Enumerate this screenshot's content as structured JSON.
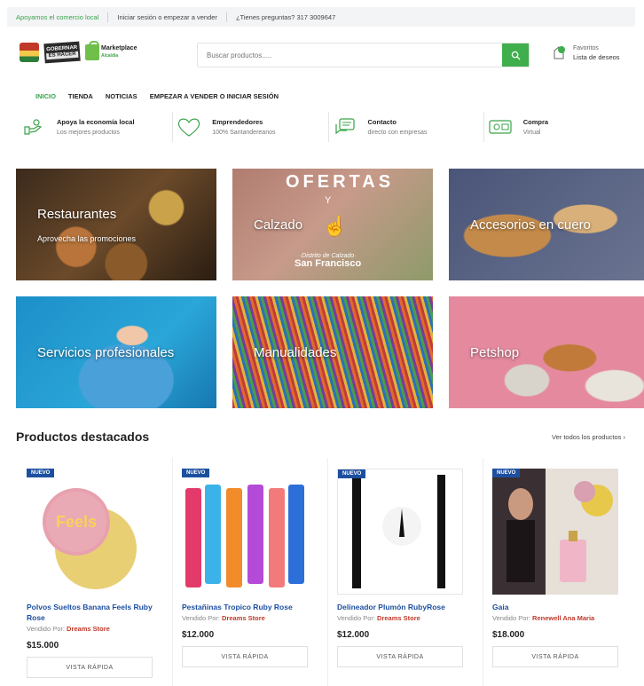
{
  "topbar": {
    "support_link": "Apoyamos el comercio local",
    "login_link": "Iniciar sesión o empezar a vender",
    "phone": "¿Tienes preguntas? 317 3009647"
  },
  "header": {
    "logo_gob_line1": "GOBERNAR",
    "logo_gob_line2": "ES HACER",
    "logo_mkt_name": "Marketplace",
    "logo_mkt_sub": "Alcaldía",
    "search_placeholder": "Buscar productos.....",
    "favorites_label": "Favoritos",
    "wishlist_label": "Lista de deseos"
  },
  "nav": {
    "items": [
      {
        "label": "INICIO",
        "active": true
      },
      {
        "label": "TIENDA"
      },
      {
        "label": "NOTICIAS"
      },
      {
        "label": "EMPEZAR A VENDER O INICIAR SESIÓN"
      }
    ]
  },
  "features": [
    {
      "icon": "handshake-icon",
      "title": "Apoya la economía local",
      "subtitle": "Los mejores productos"
    },
    {
      "icon": "heart-icon",
      "title": "Emprendedores",
      "subtitle": "100% Santandereanos"
    },
    {
      "icon": "chat-icon",
      "title": "Contacto",
      "subtitle": "directo con empresas"
    },
    {
      "icon": "card-icon",
      "title": "Compra",
      "subtitle": "Virtual"
    }
  ],
  "categories": [
    {
      "title": "Restaurantes",
      "subtitle": "Aprovecha las promociones"
    },
    {
      "title": "Calzado",
      "banner_top": "OFERTAS",
      "banner_mid": "Y",
      "banner_line1": "·Distrito de Calzado·",
      "banner_line2": "San Francisco"
    },
    {
      "title": "Accesorios en cuero"
    },
    {
      "title": "Servicios profesionales"
    },
    {
      "title": "Manualidades"
    },
    {
      "title": "Petshop"
    }
  ],
  "products_section": {
    "title": "Productos destacados",
    "see_all": "Ver todos los productos",
    "quick_view_label": "VISTA RÁPIDA",
    "badge_label": "NUEVO",
    "seller_prefix": "Vendido Por:",
    "items": [
      {
        "name": "Polvos Sueltos Banana Feels Ruby Rose",
        "seller": "Dreams Store",
        "price": "$15.000",
        "image_label": "Feels"
      },
      {
        "name": "Pestañinas Tropico Ruby Rose",
        "seller": "Dreams Store",
        "price": "$12.000"
      },
      {
        "name": "Delineador Plumón RubyRose",
        "seller": "Dreams Store",
        "price": "$12.000"
      },
      {
        "name": "Gaia",
        "seller": "Renewell Ana Maria",
        "price": "$18.000"
      }
    ]
  },
  "colors": {
    "brand_green": "#3aa34a",
    "link_blue": "#1d4fa0",
    "seller_red": "#c0392b"
  }
}
